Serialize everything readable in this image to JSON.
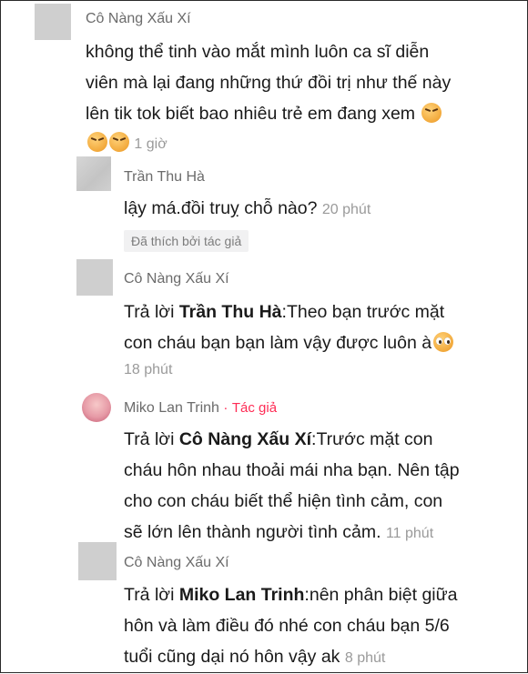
{
  "comments": [
    {
      "user": "Cô Nàng Xấu Xí",
      "lines": [
        "không thể tinh vào mắt mình luôn ca sĩ diễn",
        "viên mà lại đang những thứ đồi trị như thế này",
        "lên tik tok biết bao nhiêu trẻ em đang xem"
      ],
      "time": "1 giờ"
    },
    {
      "user": "Trần Thu Hà",
      "text": "lậy má.đồi truỵ chỗ nào?",
      "time": "20 phút",
      "liked_badge": "Đã thích bởi tác giả"
    },
    {
      "user": "Cô Nàng Xấu Xí",
      "reply_prefix": "Trả lời",
      "reply_to": "Trần Thu Hà",
      "line1_rest": "Theo bạn trước mặt",
      "line2": "con cháu bạn bạn làm vậy được luôn à",
      "time": "18 phút"
    },
    {
      "user": "Miko Lan Trinh",
      "separator": "·",
      "author_tag": "Tác giả",
      "reply_prefix": "Trả lời",
      "reply_to": "Cô Nàng Xấu Xí",
      "line1_rest": "Trước mặt con",
      "line2": "cháu hôn nhau thoải mái nha bạn. Nên tập",
      "line3": "cho con cháu biết thể hiện tình cảm, con",
      "line4": "sẽ lớn lên thành người tình cảm.",
      "time": "11 phút"
    },
    {
      "user": "Cô Nàng Xấu Xí",
      "reply_prefix": "Trả lời",
      "reply_to": "Miko Lan Trinh",
      "line1_rest": "nên phân biệt giữa",
      "line2": "hôn và làm điều đó nhé con cháu bạn 5/6",
      "line3": "tuổi cũng dại nó hôn vậy ak",
      "time": "8 phút"
    }
  ]
}
